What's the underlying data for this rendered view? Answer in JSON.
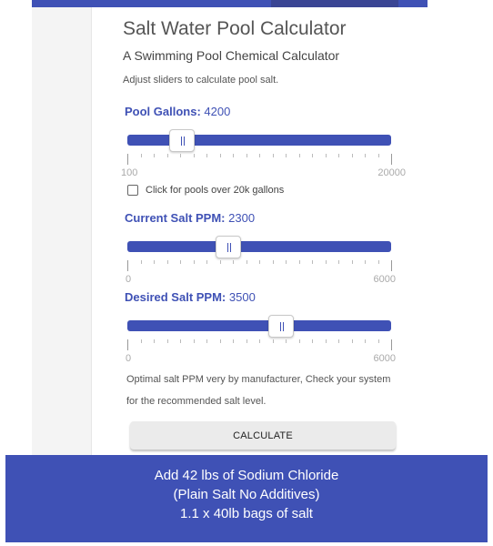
{
  "app": {
    "title": "Salt Water Pool Calculator",
    "subtitle": "A Swimming Pool Chemical Calculator",
    "instructions": "Adjust sliders to calculate pool salt."
  },
  "colors": {
    "primary": "#3f51b5",
    "button_bg": "#ebebeb"
  },
  "sliders": [
    {
      "label": "Pool Gallons:",
      "value": "4200",
      "numeric_value": 4200,
      "min": 100,
      "max": 20000,
      "min_label": "100",
      "max_label": "20000"
    },
    {
      "label": "Current Salt PPM:",
      "value": "2300",
      "numeric_value": 2300,
      "min": 0,
      "max": 6000,
      "min_label": "0",
      "max_label": "6000"
    },
    {
      "label": "Desired Salt PPM:",
      "value": "3500",
      "numeric_value": 3500,
      "min": 0,
      "max": 6000,
      "min_label": "0",
      "max_label": "6000"
    }
  ],
  "large_pool_checkbox": {
    "label": "Click for pools over 20k gallons",
    "checked": false
  },
  "note": "Optimal salt PPM very by manufacturer, Check your system for the recommended salt level.",
  "calculate_button": "CALCULATE",
  "result": {
    "line1": "Add 42 lbs of Sodium Chloride",
    "line2": "(Plain Salt No Additives)",
    "line3": "1.1 x 40lb bags of salt"
  }
}
